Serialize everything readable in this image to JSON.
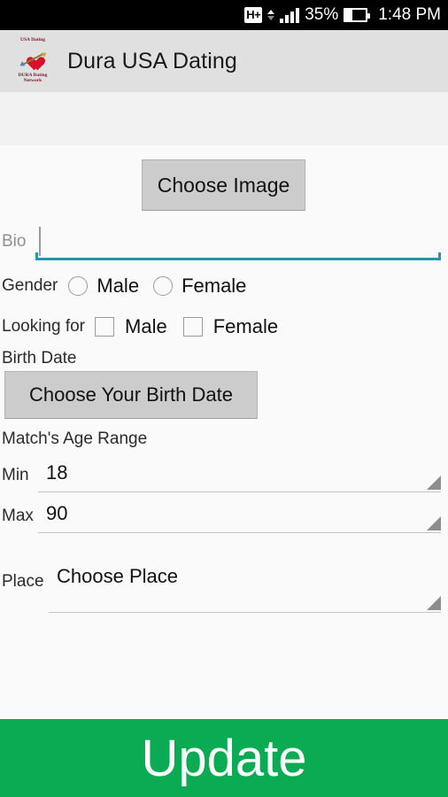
{
  "status_bar": {
    "network_type": "H+",
    "battery_percent": "35%",
    "battery_level": 35,
    "time": "1:48 PM",
    "signal_bars": 4,
    "icons": {
      "network": "hspa-plus-icon",
      "data_transfer": "data-arrows-icon",
      "signal": "signal-bars-icon",
      "battery": "battery-icon"
    }
  },
  "toolbar": {
    "title": "Dura USA Dating",
    "logo": {
      "top_caption": "USA Dating",
      "bottom_caption": "DURA Dating Network",
      "icon": "heart-with-arrow-icon"
    }
  },
  "form": {
    "choose_image_label": "Choose Image",
    "bio": {
      "label": "Bio",
      "value": "",
      "placeholder": "Bio",
      "focused": true
    },
    "gender": {
      "label": "Gender",
      "options": [
        {
          "label": "Male",
          "checked": false
        },
        {
          "label": "Female",
          "checked": false
        }
      ]
    },
    "looking_for": {
      "label": "Looking for",
      "options": [
        {
          "label": "Male",
          "checked": false
        },
        {
          "label": "Female",
          "checked": false
        }
      ]
    },
    "birth_date": {
      "label": "Birth Date",
      "button_label": "Choose Your Birth Date"
    },
    "age_range": {
      "label": "Match's Age Range",
      "min": {
        "label": "Min",
        "value": "18"
      },
      "max": {
        "label": "Max",
        "value": "90"
      }
    },
    "place": {
      "label": "Place",
      "value": "Choose Place"
    }
  },
  "footer": {
    "update_label": "Update"
  },
  "colors": {
    "accent_green": "#0bab53",
    "focus_teal": "#2296aa",
    "toolbar_gray": "#e0e0e0",
    "button_gray": "#cccccc",
    "heart_red": "#d8112a"
  }
}
